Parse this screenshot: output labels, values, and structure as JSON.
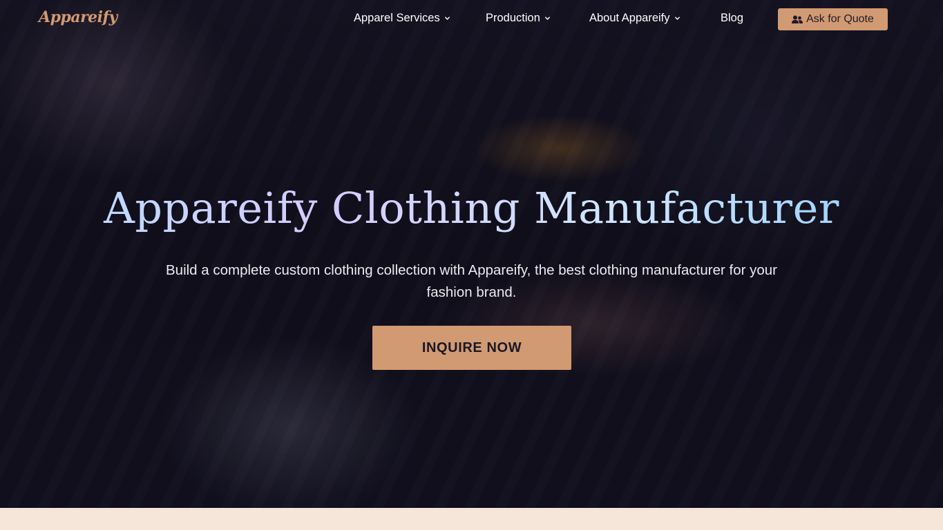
{
  "brand": {
    "logo_text": "Appareify",
    "logo_color": "#d29a72"
  },
  "nav": {
    "items": [
      {
        "label": "Apparel Services",
        "has_dropdown": true
      },
      {
        "label": "Production",
        "has_dropdown": true
      },
      {
        "label": "About Appareify",
        "has_dropdown": true
      },
      {
        "label": "Blog",
        "has_dropdown": false
      }
    ],
    "quote_button": {
      "label": "Ask for Quote",
      "icon": "users-icon"
    }
  },
  "hero": {
    "title": "Appareify Clothing Manufacturer",
    "subtitle": "Build a complete custom clothing collection with Appareify, the best clothing manufacturer for your fashion brand.",
    "cta_label": "INQUIRE NOW"
  },
  "colors": {
    "accent": "#d29a72",
    "hero_overlay": "#15131f",
    "section_bg": "#f6e6da",
    "title_gradient": [
      "#b5e0ff",
      "#d7cbff",
      "#8fcbff"
    ]
  }
}
